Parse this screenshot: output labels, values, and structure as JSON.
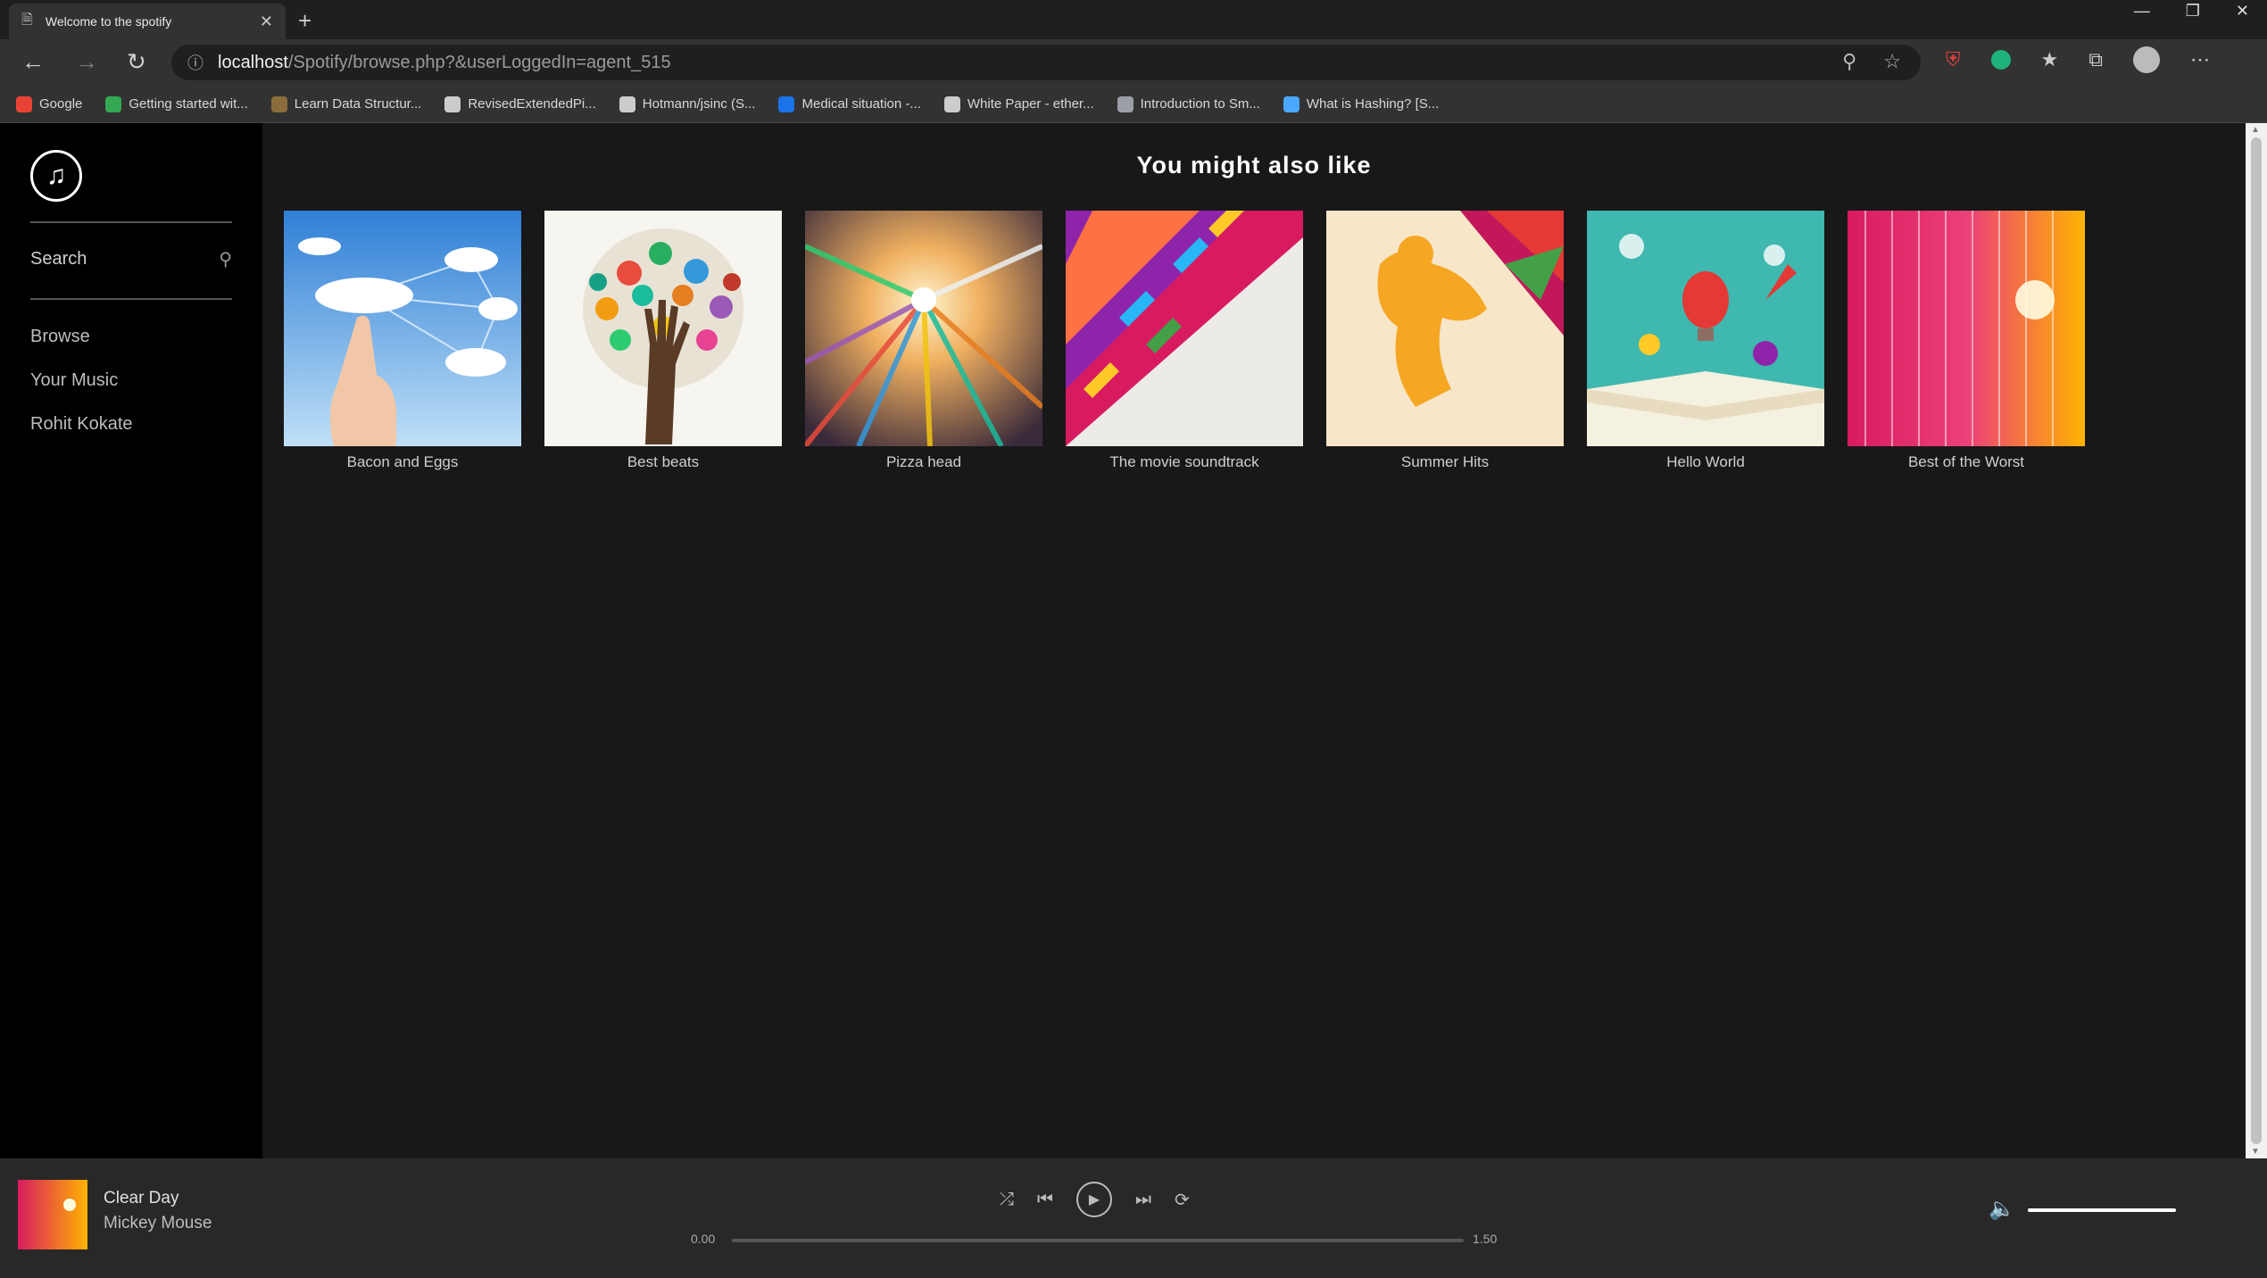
{
  "browser": {
    "tab_title": "Welcome to the spotify",
    "url_host": "localhost",
    "url_path": "/Spotify/browse.php?&userLoggedIn=agent_515",
    "bookmarks": [
      {
        "label": "Google",
        "color": "#e94335"
      },
      {
        "label": "Getting started wit...",
        "color": "#34a853"
      },
      {
        "label": "Learn Data Structur...",
        "color": "#8a6d3b"
      },
      {
        "label": "RevisedExtendedPi...",
        "color": "#cccccc"
      },
      {
        "label": "Hotmann/jsinc (S...",
        "color": "#cccccc"
      },
      {
        "label": "Medical situation -...",
        "color": "#1a73e8"
      },
      {
        "label": "White Paper - ether...",
        "color": "#cccccc"
      },
      {
        "label": "Introduction to Sm...",
        "color": "#9aa0a6"
      },
      {
        "label": "What is Hashing? [S...",
        "color": "#4aa8ff"
      }
    ]
  },
  "sidebar": {
    "search_placeholder": "Search",
    "items": [
      {
        "label": "Browse"
      },
      {
        "label": "Your Music"
      },
      {
        "label": "Rohit Kokate"
      }
    ]
  },
  "main": {
    "title": "You might also like",
    "albums": [
      {
        "label": "Bacon and Eggs",
        "cover": "cloud-hand"
      },
      {
        "label": "Best beats",
        "cover": "hand-tree"
      },
      {
        "label": "Pizza head",
        "cover": "burst"
      },
      {
        "label": "The movie soundtrack",
        "cover": "arrows"
      },
      {
        "label": "Summer Hits",
        "cover": "runner"
      },
      {
        "label": "Hello World",
        "cover": "balloon-book"
      },
      {
        "label": "Best of the Worst",
        "cover": "sparkle"
      }
    ]
  },
  "player": {
    "track_title": "Clear Day",
    "track_artist": "Mickey Mouse",
    "time_current": "0.00",
    "time_total": "1.50",
    "progress": 0,
    "volume": 1
  },
  "colors": {
    "sidebar_bg": "#000000",
    "main_bg": "#181818",
    "player_bg": "#282828"
  }
}
